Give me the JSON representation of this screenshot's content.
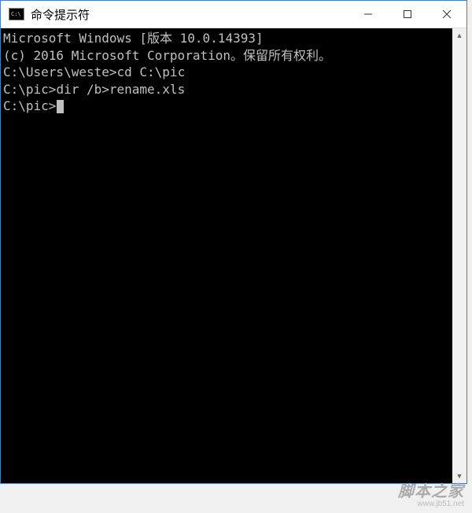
{
  "window": {
    "title": "命令提示符",
    "icon_label": "C:\\"
  },
  "terminal": {
    "line1": "Microsoft Windows [版本 10.0.14393]",
    "line2": "(c) 2016 Microsoft Corporation。保留所有权利。",
    "blank": "",
    "prompt1_path": "C:\\Users\\weste>",
    "prompt1_cmd": "cd C:\\pic",
    "prompt2_path": "C:\\pic>",
    "prompt2_cmd": "dir /b>rename.xls",
    "prompt3_path": "C:\\pic>",
    "prompt3_cmd": ""
  },
  "watermark": {
    "main": "脚本之家",
    "sub": "www.jb51.net"
  }
}
